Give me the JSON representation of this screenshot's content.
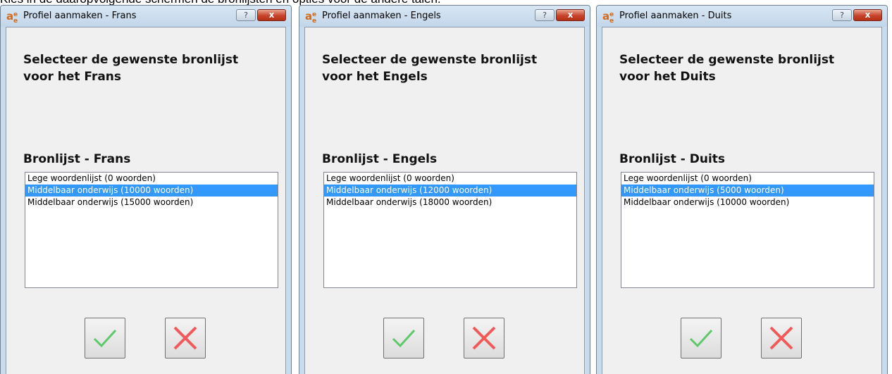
{
  "instruction": "Kies in de daaropvolgende schermen de bronlijsten en opties voor de andere talen.",
  "icons": {
    "app": "app-logo-icon",
    "help": "help-icon",
    "close": "close-icon",
    "ok": "checkmark-icon",
    "cancel": "cross-icon"
  },
  "colors": {
    "selection": "#3399ff",
    "check": "#4caf50",
    "cross": "#e53935"
  },
  "windows": [
    {
      "title": "Profiel aanmaken - Frans",
      "help_label": "?",
      "close_label": "x",
      "heading": "Selecteer de gewenste bronlijst voor het Frans",
      "list_label": "Bronlijst - Frans",
      "items": [
        "Lege woordenlijst (0 woorden)",
        "Middelbaar onderwijs (10000 woorden)",
        "Middelbaar onderwijs (15000 woorden)"
      ],
      "selected_index": 1
    },
    {
      "title": "Profiel aanmaken - Engels",
      "help_label": "?",
      "close_label": "x",
      "heading": "Selecteer de gewenste bronlijst voor het Engels",
      "list_label": "Bronlijst - Engels",
      "items": [
        "Lege woordenlijst (0 woorden)",
        "Middelbaar onderwijs (12000 woorden)",
        "Middelbaar onderwijs (18000 woorden)"
      ],
      "selected_index": 1
    },
    {
      "title": "Profiel aanmaken - Duits",
      "help_label": "?",
      "close_label": "x",
      "heading": "Selecteer de gewenste bronlijst voor het Duits",
      "list_label": "Bronlijst - Duits",
      "items": [
        "Lege woordenlijst (0 woorden)",
        "Middelbaar onderwijs (5000 woorden)",
        "Middelbaar onderwijs (10000 woorden)"
      ],
      "selected_index": 1
    }
  ]
}
